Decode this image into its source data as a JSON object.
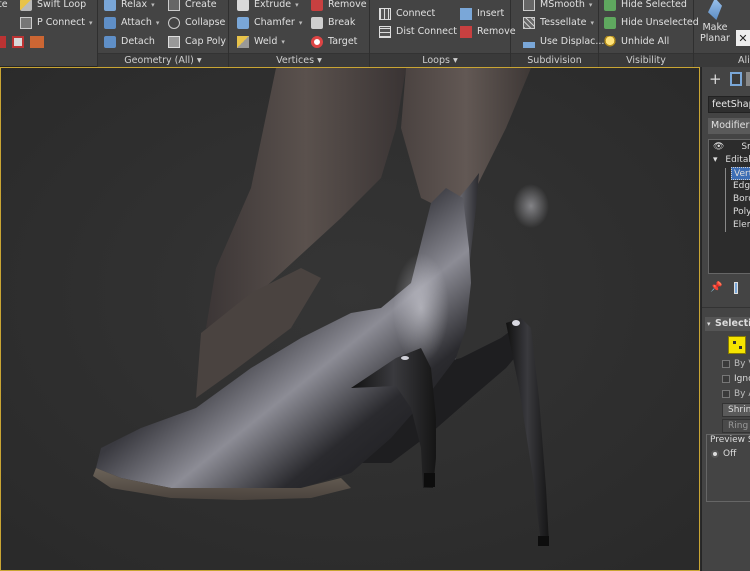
{
  "ribbon": {
    "col1": {
      "swift_loop": "Swift Loop",
      "p_connect": "P Connect"
    },
    "geometry": {
      "relax": "Relax",
      "attach": "Attach",
      "detach": "Detach",
      "create": "Create",
      "collapse": "Collapse",
      "cap_poly": "Cap Poly",
      "footer": "Geometry (All)"
    },
    "vertices": {
      "extrude": "Extrude",
      "chamfer": "Chamfer",
      "weld": "Weld",
      "remove": "Remove",
      "break": "Break",
      "target": "Target",
      "footer": "Vertices"
    },
    "loops": {
      "connect": "Connect",
      "dist_connect": "Dist Connect",
      "insert": "Insert",
      "remove": "Remove",
      "footer": "Loops"
    },
    "subdivision": {
      "msmooth": "MSmooth",
      "tessellate": "Tessellate",
      "use_displace": "Use Displac...",
      "footer": "Subdivision"
    },
    "visibility": {
      "hide_selected": "Hide Selected",
      "hide_unselected": "Hide Unselected",
      "unhide_all": "Unhide All",
      "footer": "Visibility"
    },
    "align": {
      "make_planar_1": "Make",
      "make_planar_2": "Planar",
      "footer": "Alig"
    }
  },
  "command_panel": {
    "object_name": "feetShape",
    "modifier_list": "Modifier List",
    "stack": {
      "smooth": "Sm",
      "editable": "Editable Poly",
      "items": [
        "Vertex",
        "Edge",
        "Border",
        "Polygon",
        "Element"
      ]
    },
    "selection": {
      "header": "Selection",
      "by_vertex": "By Vertex",
      "ignore": "Ignore Backfacing",
      "by_angle": "By Angle",
      "shrink": "Shrink",
      "ring": "Ring",
      "preview": "Preview Selection",
      "off": "Off"
    }
  },
  "colors": {
    "accent": "#c9a533",
    "selection_blue": "#3d6eb5",
    "ribbon_bg": "#444444",
    "viewport_bg": "#2e2e2e"
  }
}
